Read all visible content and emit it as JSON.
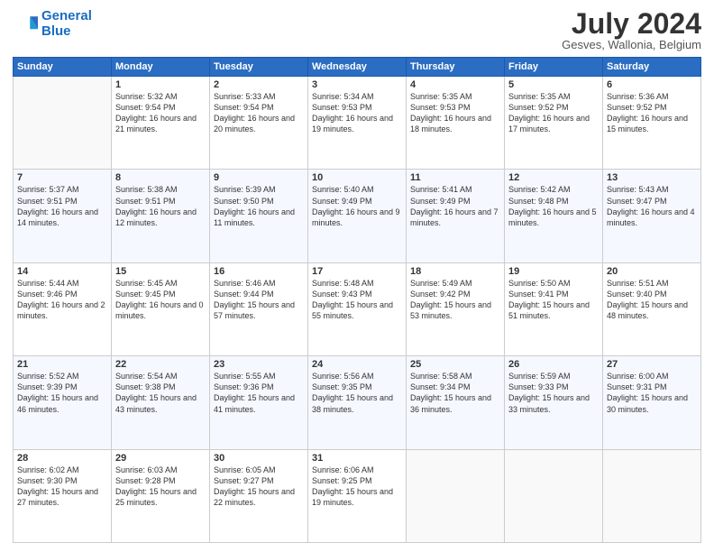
{
  "logo": {
    "line1": "General",
    "line2": "Blue"
  },
  "title": "July 2024",
  "subtitle": "Gesves, Wallonia, Belgium",
  "days_of_week": [
    "Sunday",
    "Monday",
    "Tuesday",
    "Wednesday",
    "Thursday",
    "Friday",
    "Saturday"
  ],
  "weeks": [
    [
      {
        "day": "",
        "sunrise": "",
        "sunset": "",
        "daylight": ""
      },
      {
        "day": "1",
        "sunrise": "Sunrise: 5:32 AM",
        "sunset": "Sunset: 9:54 PM",
        "daylight": "Daylight: 16 hours and 21 minutes."
      },
      {
        "day": "2",
        "sunrise": "Sunrise: 5:33 AM",
        "sunset": "Sunset: 9:54 PM",
        "daylight": "Daylight: 16 hours and 20 minutes."
      },
      {
        "day": "3",
        "sunrise": "Sunrise: 5:34 AM",
        "sunset": "Sunset: 9:53 PM",
        "daylight": "Daylight: 16 hours and 19 minutes."
      },
      {
        "day": "4",
        "sunrise": "Sunrise: 5:35 AM",
        "sunset": "Sunset: 9:53 PM",
        "daylight": "Daylight: 16 hours and 18 minutes."
      },
      {
        "day": "5",
        "sunrise": "Sunrise: 5:35 AM",
        "sunset": "Sunset: 9:52 PM",
        "daylight": "Daylight: 16 hours and 17 minutes."
      },
      {
        "day": "6",
        "sunrise": "Sunrise: 5:36 AM",
        "sunset": "Sunset: 9:52 PM",
        "daylight": "Daylight: 16 hours and 15 minutes."
      }
    ],
    [
      {
        "day": "7",
        "sunrise": "Sunrise: 5:37 AM",
        "sunset": "Sunset: 9:51 PM",
        "daylight": "Daylight: 16 hours and 14 minutes."
      },
      {
        "day": "8",
        "sunrise": "Sunrise: 5:38 AM",
        "sunset": "Sunset: 9:51 PM",
        "daylight": "Daylight: 16 hours and 12 minutes."
      },
      {
        "day": "9",
        "sunrise": "Sunrise: 5:39 AM",
        "sunset": "Sunset: 9:50 PM",
        "daylight": "Daylight: 16 hours and 11 minutes."
      },
      {
        "day": "10",
        "sunrise": "Sunrise: 5:40 AM",
        "sunset": "Sunset: 9:49 PM",
        "daylight": "Daylight: 16 hours and 9 minutes."
      },
      {
        "day": "11",
        "sunrise": "Sunrise: 5:41 AM",
        "sunset": "Sunset: 9:49 PM",
        "daylight": "Daylight: 16 hours and 7 minutes."
      },
      {
        "day": "12",
        "sunrise": "Sunrise: 5:42 AM",
        "sunset": "Sunset: 9:48 PM",
        "daylight": "Daylight: 16 hours and 5 minutes."
      },
      {
        "day": "13",
        "sunrise": "Sunrise: 5:43 AM",
        "sunset": "Sunset: 9:47 PM",
        "daylight": "Daylight: 16 hours and 4 minutes."
      }
    ],
    [
      {
        "day": "14",
        "sunrise": "Sunrise: 5:44 AM",
        "sunset": "Sunset: 9:46 PM",
        "daylight": "Daylight: 16 hours and 2 minutes."
      },
      {
        "day": "15",
        "sunrise": "Sunrise: 5:45 AM",
        "sunset": "Sunset: 9:45 PM",
        "daylight": "Daylight: 16 hours and 0 minutes."
      },
      {
        "day": "16",
        "sunrise": "Sunrise: 5:46 AM",
        "sunset": "Sunset: 9:44 PM",
        "daylight": "Daylight: 15 hours and 57 minutes."
      },
      {
        "day": "17",
        "sunrise": "Sunrise: 5:48 AM",
        "sunset": "Sunset: 9:43 PM",
        "daylight": "Daylight: 15 hours and 55 minutes."
      },
      {
        "day": "18",
        "sunrise": "Sunrise: 5:49 AM",
        "sunset": "Sunset: 9:42 PM",
        "daylight": "Daylight: 15 hours and 53 minutes."
      },
      {
        "day": "19",
        "sunrise": "Sunrise: 5:50 AM",
        "sunset": "Sunset: 9:41 PM",
        "daylight": "Daylight: 15 hours and 51 minutes."
      },
      {
        "day": "20",
        "sunrise": "Sunrise: 5:51 AM",
        "sunset": "Sunset: 9:40 PM",
        "daylight": "Daylight: 15 hours and 48 minutes."
      }
    ],
    [
      {
        "day": "21",
        "sunrise": "Sunrise: 5:52 AM",
        "sunset": "Sunset: 9:39 PM",
        "daylight": "Daylight: 15 hours and 46 minutes."
      },
      {
        "day": "22",
        "sunrise": "Sunrise: 5:54 AM",
        "sunset": "Sunset: 9:38 PM",
        "daylight": "Daylight: 15 hours and 43 minutes."
      },
      {
        "day": "23",
        "sunrise": "Sunrise: 5:55 AM",
        "sunset": "Sunset: 9:36 PM",
        "daylight": "Daylight: 15 hours and 41 minutes."
      },
      {
        "day": "24",
        "sunrise": "Sunrise: 5:56 AM",
        "sunset": "Sunset: 9:35 PM",
        "daylight": "Daylight: 15 hours and 38 minutes."
      },
      {
        "day": "25",
        "sunrise": "Sunrise: 5:58 AM",
        "sunset": "Sunset: 9:34 PM",
        "daylight": "Daylight: 15 hours and 36 minutes."
      },
      {
        "day": "26",
        "sunrise": "Sunrise: 5:59 AM",
        "sunset": "Sunset: 9:33 PM",
        "daylight": "Daylight: 15 hours and 33 minutes."
      },
      {
        "day": "27",
        "sunrise": "Sunrise: 6:00 AM",
        "sunset": "Sunset: 9:31 PM",
        "daylight": "Daylight: 15 hours and 30 minutes."
      }
    ],
    [
      {
        "day": "28",
        "sunrise": "Sunrise: 6:02 AM",
        "sunset": "Sunset: 9:30 PM",
        "daylight": "Daylight: 15 hours and 27 minutes."
      },
      {
        "day": "29",
        "sunrise": "Sunrise: 6:03 AM",
        "sunset": "Sunset: 9:28 PM",
        "daylight": "Daylight: 15 hours and 25 minutes."
      },
      {
        "day": "30",
        "sunrise": "Sunrise: 6:05 AM",
        "sunset": "Sunset: 9:27 PM",
        "daylight": "Daylight: 15 hours and 22 minutes."
      },
      {
        "day": "31",
        "sunrise": "Sunrise: 6:06 AM",
        "sunset": "Sunset: 9:25 PM",
        "daylight": "Daylight: 15 hours and 19 minutes."
      },
      {
        "day": "",
        "sunrise": "",
        "sunset": "",
        "daylight": ""
      },
      {
        "day": "",
        "sunrise": "",
        "sunset": "",
        "daylight": ""
      },
      {
        "day": "",
        "sunrise": "",
        "sunset": "",
        "daylight": ""
      }
    ]
  ]
}
